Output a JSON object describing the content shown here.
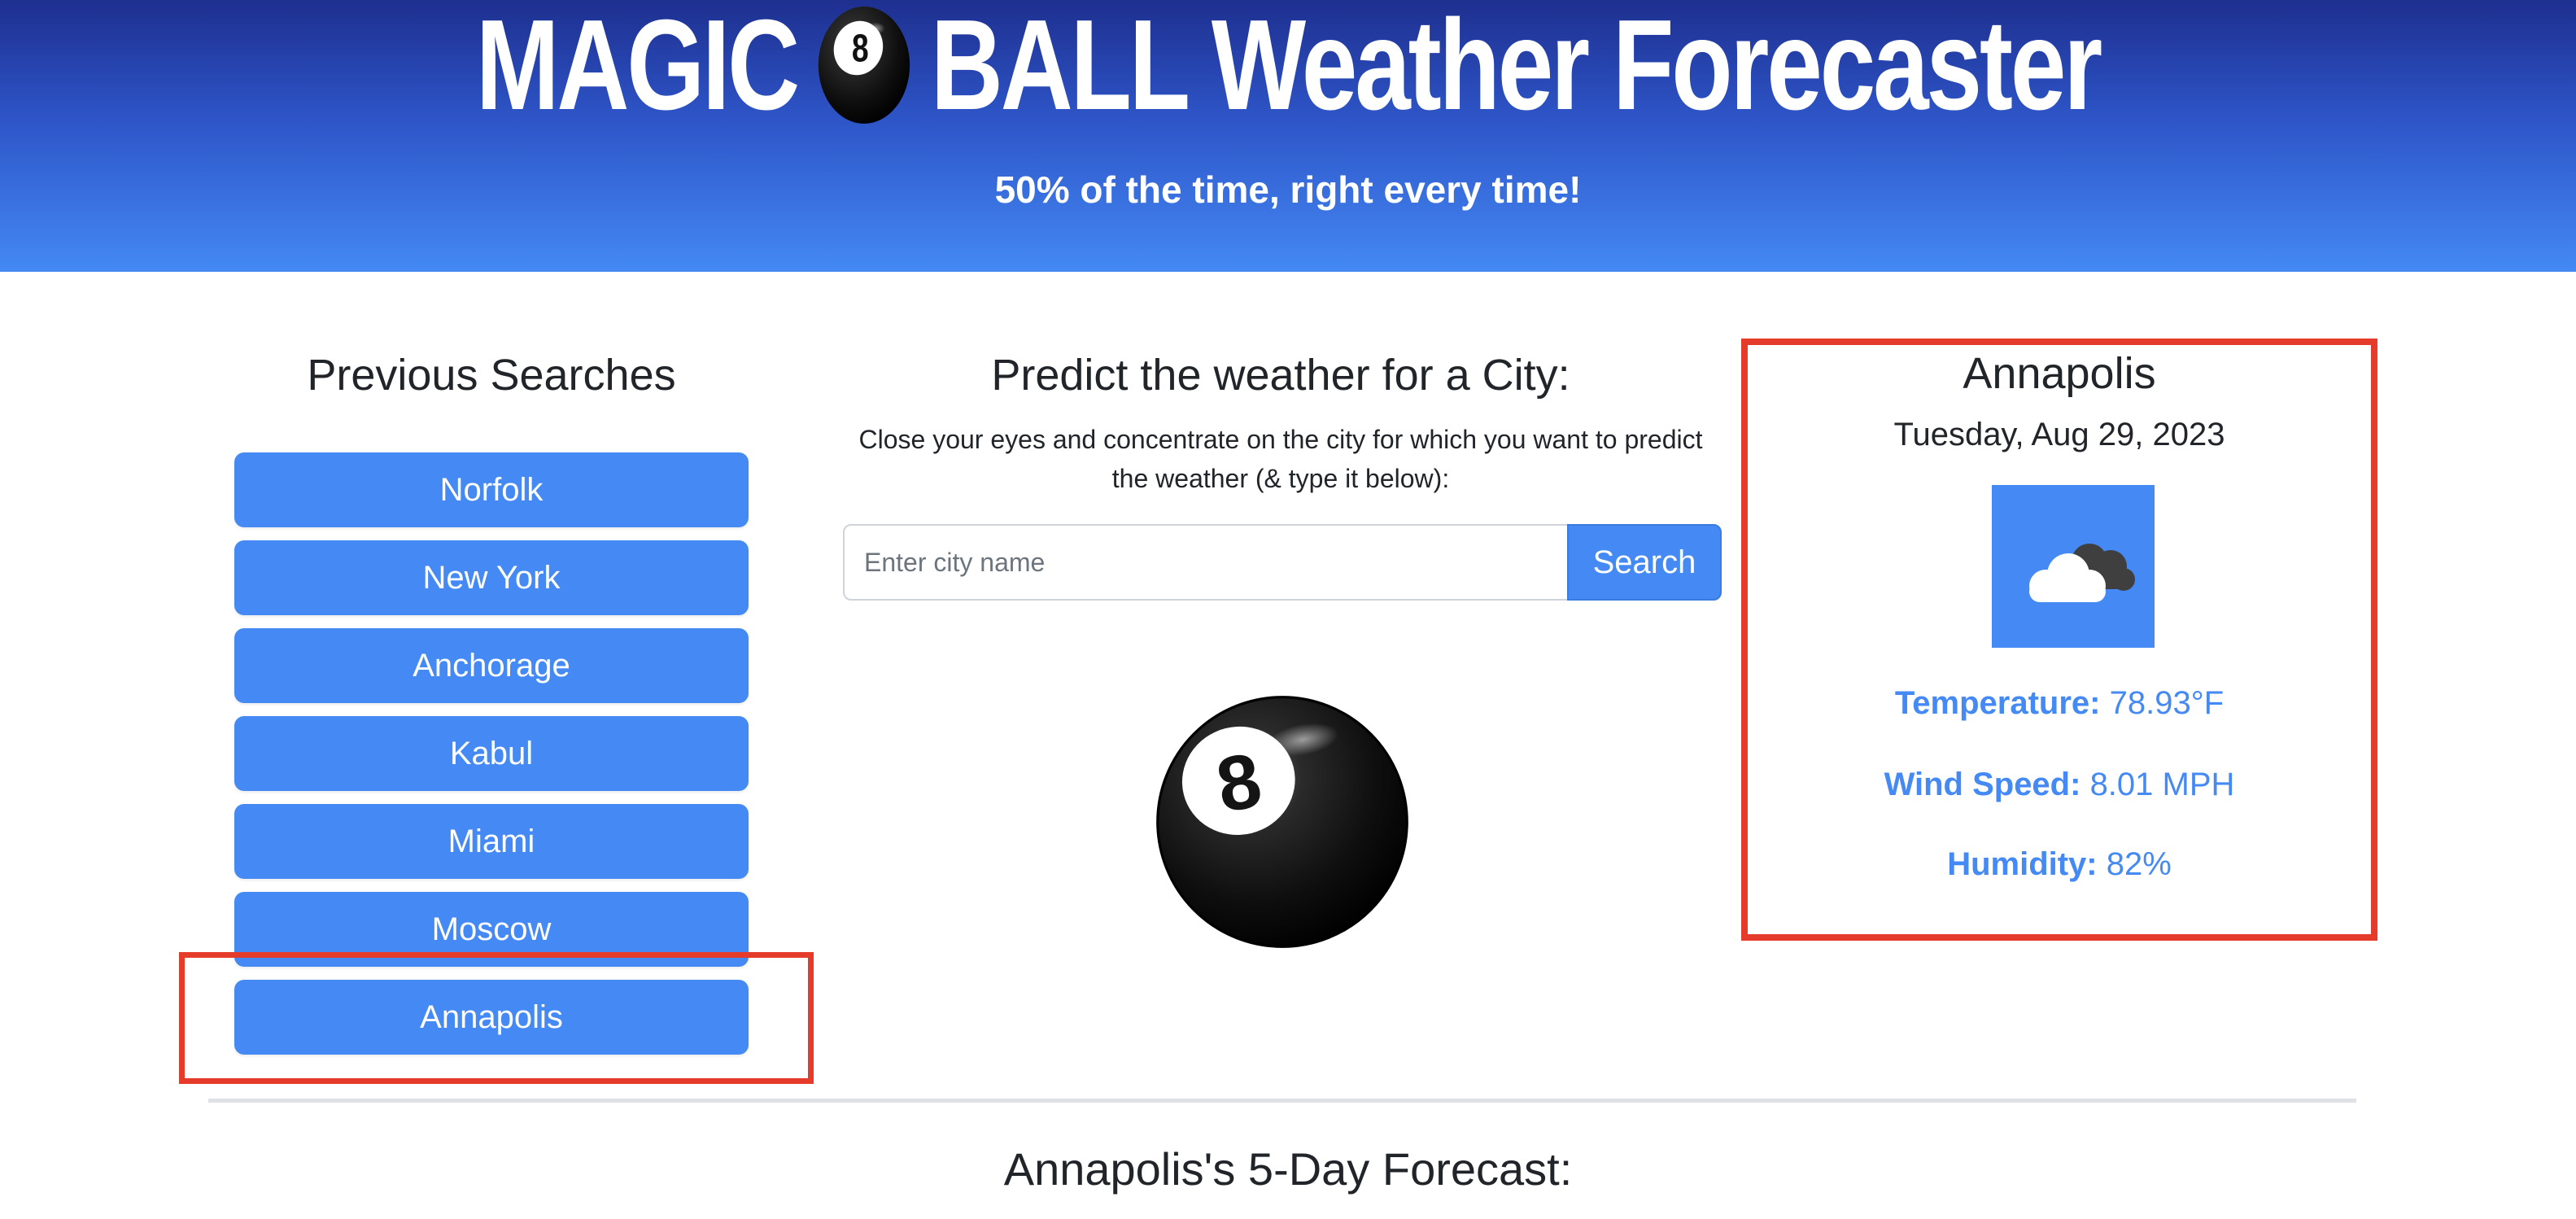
{
  "header": {
    "title_left": "MAGIC",
    "title_ball_icon": "8-ball-icon",
    "title_right": "BALL Weather Forecaster",
    "subtitle": "50% of the time, right every time!",
    "gradient_top": "#1e2f8f",
    "gradient_bottom": "#4489f4"
  },
  "history": {
    "heading": "Previous Searches",
    "items": [
      {
        "label": "Norfolk"
      },
      {
        "label": "New York"
      },
      {
        "label": "Anchorage"
      },
      {
        "label": "Kabul"
      },
      {
        "label": "Miami"
      },
      {
        "label": "Moscow"
      },
      {
        "label": "Annapolis"
      }
    ],
    "button_color": "#4489f4"
  },
  "search": {
    "heading": "Predict the weather for a City:",
    "instructions": "Close your eyes and concentrate on the city for which you want to predict the weather (& type it below):",
    "placeholder": "Enter city name",
    "value": "",
    "button_label": "Search"
  },
  "current": {
    "city": "Annapolis",
    "date": "Tuesday, Aug 29, 2023",
    "icon": "cloudy-icon",
    "temperature_label": "Temperature:",
    "temperature_value": "78.93°F",
    "wind_label": "Wind Speed:",
    "wind_value": "8.01 MPH",
    "humidity_label": "Humidity:",
    "humidity_value": "82%",
    "accent_color": "#4489f4"
  },
  "forecast": {
    "heading": "Annapolis's 5-Day Forecast:"
  },
  "highlight_color": "#e53b2b"
}
